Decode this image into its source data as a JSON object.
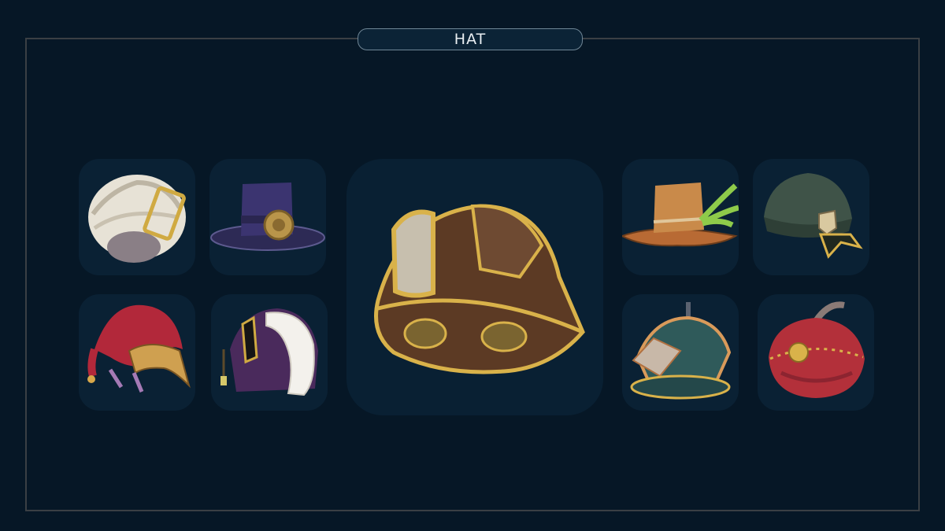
{
  "header": {
    "title": "HAT"
  },
  "inventory": {
    "selected_item_icon": "miner-helmet-icon",
    "items": [
      {
        "icon": "turban-icon",
        "color": "#e9e4da"
      },
      {
        "icon": "top-hat-icon",
        "color": "#3b3470"
      },
      {
        "icon": "jester-mask-hat-icon",
        "color": "#b2283a"
      },
      {
        "icon": "fur-hood-icon",
        "color": "#4a2a5c"
      },
      {
        "icon": "ranger-hat-icon",
        "color": "#c98a4a"
      },
      {
        "icon": "beanie-cap-icon",
        "color": "#3f5348"
      },
      {
        "icon": "gladiator-helmet-icon",
        "color": "#2f5a5a"
      },
      {
        "icon": "red-turban-icon",
        "color": "#b3303a"
      }
    ]
  },
  "colors": {
    "background": "#061726",
    "slot": "#0a2134",
    "frame": "#3a3f44",
    "accent_gold": "#d9b24a"
  }
}
